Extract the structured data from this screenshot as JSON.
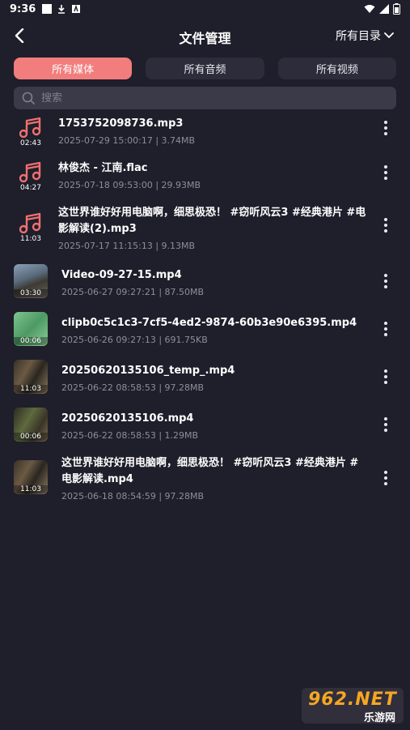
{
  "status": {
    "time": "9:36"
  },
  "header": {
    "title": "文件管理",
    "directory": "所有目录"
  },
  "tabs": [
    {
      "label": "所有媒体",
      "active": true
    },
    {
      "label": "所有音频",
      "active": false
    },
    {
      "label": "所有视频",
      "active": false
    }
  ],
  "search": {
    "placeholder": "搜索"
  },
  "files": [
    {
      "name": "1753752098736.mp3",
      "meta": "2025-07-29 15:00:17 | 3.74MB",
      "duration": "02:43",
      "kind": "audio"
    },
    {
      "name": "林俊杰 - 江南.flac",
      "meta": "2025-07-18 09:53:00 | 29.93MB",
      "duration": "04:27",
      "kind": "audio"
    },
    {
      "name_line1": "这世界谁好好用电脑啊，细思极恐！ #窃听风云3 #经典港片 #电",
      "name_line2": "影解读(2).mp3",
      "meta": "2025-07-17 11:15:13 | 9.13MB",
      "duration": "11:03",
      "kind": "audio"
    },
    {
      "name": "Video-09-27-15.mp4",
      "meta": "2025-06-27 09:27:21 | 87.50MB",
      "duration": "03:30",
      "kind": "video"
    },
    {
      "name": "clipb0c5c1c3-7cf5-4ed2-9874-60b3e90e6395.mp4",
      "meta": "2025-06-26 09:27:13 | 691.75KB",
      "duration": "00:06",
      "kind": "video"
    },
    {
      "name": "20250620135106_temp_.mp4",
      "meta": "2025-06-22 08:58:53 | 97.28MB",
      "duration": "11:03",
      "kind": "video"
    },
    {
      "name": "20250620135106.mp4",
      "meta": "2025-06-22 08:58:53 | 1.29MB",
      "duration": "00:06",
      "kind": "video"
    },
    {
      "name_line1": "这世界谁好好用电脑啊，细思极恐！ #窃听风云3 #经典港片 #",
      "name_line2": "电影解读.mp4",
      "meta": "2025-06-18 08:54:59 | 97.28MB",
      "duration": "11:03",
      "kind": "video"
    }
  ],
  "watermark": {
    "brand": "962.NET",
    "sub": "乐游网"
  },
  "colors": {
    "accent": "#f27d7d",
    "background": "#1f1e2b"
  }
}
